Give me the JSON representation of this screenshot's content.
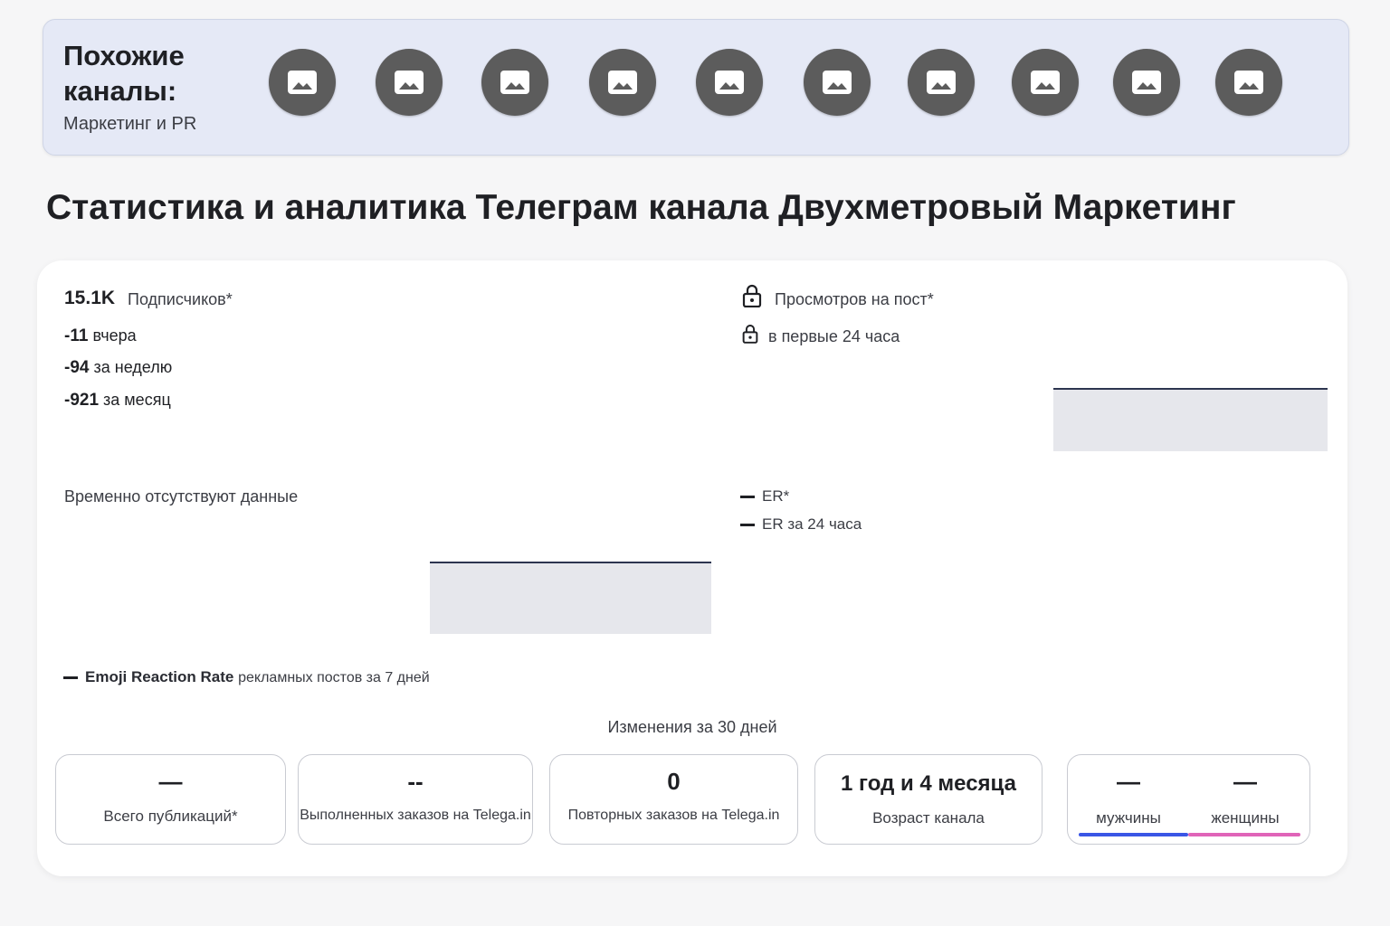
{
  "similar": {
    "title": "Похожие каналы:",
    "subtitle": "Маркетинг и PR",
    "avatar_icon": "image-placeholder-icon",
    "avatar_count": 10
  },
  "page_title": "Статистика и аналитика Телеграм канала Двухметровый Маркетинг",
  "subscribers": {
    "count": "15.1K",
    "label": "Подписчиков*",
    "deltas": [
      {
        "value": "-11",
        "label": "вчера"
      },
      {
        "value": "-94",
        "label": "за неделю"
      },
      {
        "value": "-921",
        "label": "за месяц"
      }
    ]
  },
  "views": {
    "per_post": "Просмотров на пост*",
    "first_24h": "в первые 24 часа",
    "lock_icon": "lock-icon"
  },
  "no_data": "Временно отсутствуют данные",
  "er": {
    "er": "ER*",
    "er_24": "ER за 24 часа"
  },
  "emoji_rate": {
    "name": "Emoji Reaction Rate",
    "suffix": "рекламных постов за 7 дней"
  },
  "changes_label": "Изменения за 30 дней",
  "stats": {
    "publications": {
      "value": "—",
      "label": "Всего публикаций*"
    },
    "orders": {
      "value": "--",
      "label": "Выполненных заказов на Telega.in"
    },
    "repeat": {
      "value": "0",
      "label": "Повторных заказов на Telega.in"
    },
    "age": {
      "value": "1 год и 4 месяца",
      "label": "Возраст канала"
    },
    "gender": {
      "male_value": "—",
      "male_label": "мужчины",
      "female_value": "—",
      "female_label": "женщины",
      "male_color": "#3a56e6",
      "female_color": "#e064b8"
    }
  }
}
